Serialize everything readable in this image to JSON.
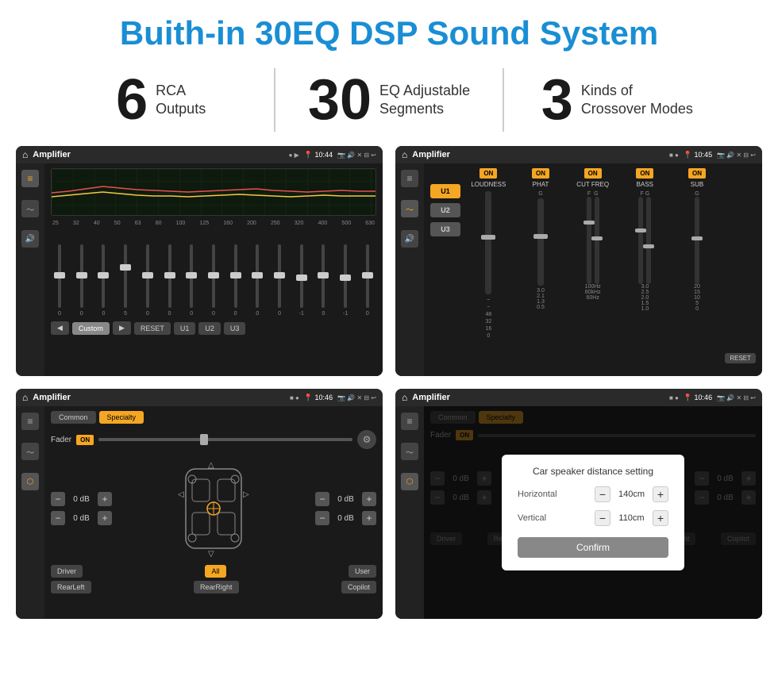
{
  "page": {
    "title": "Buith-in 30EQ DSP Sound System",
    "stats": [
      {
        "number": "6",
        "label": "RCA\nOutputs"
      },
      {
        "number": "30",
        "label": "EQ Adjustable\nSegments"
      },
      {
        "number": "3",
        "label": "Kinds of\nCrossover Modes"
      }
    ],
    "screens": [
      {
        "id": "screen1",
        "statusbar": {
          "title": "Amplifier",
          "time": "10:44"
        },
        "type": "eq"
      },
      {
        "id": "screen2",
        "statusbar": {
          "title": "Amplifier",
          "time": "10:45"
        },
        "type": "amp2"
      },
      {
        "id": "screen3",
        "statusbar": {
          "title": "Amplifier",
          "time": "10:46"
        },
        "type": "crossover"
      },
      {
        "id": "screen4",
        "statusbar": {
          "title": "Amplifier",
          "time": "10:46"
        },
        "type": "crossover-dialog",
        "dialog": {
          "title": "Car speaker distance setting",
          "horizontal_label": "Horizontal",
          "horizontal_value": "140cm",
          "vertical_label": "Vertical",
          "vertical_value": "110cm",
          "confirm_label": "Confirm"
        }
      }
    ],
    "eq": {
      "freqs": [
        "25",
        "32",
        "40",
        "50",
        "63",
        "80",
        "100",
        "125",
        "160",
        "200",
        "250",
        "320",
        "400",
        "500",
        "630"
      ],
      "values": [
        "0",
        "0",
        "0",
        "5",
        "0",
        "0",
        "0",
        "0",
        "0",
        "0",
        "0",
        "-1",
        "0",
        "-1"
      ],
      "presets": [
        "Custom",
        "RESET",
        "U1",
        "U2",
        "U3"
      ]
    },
    "amp2": {
      "presets": [
        "U1",
        "U2",
        "U3"
      ],
      "channels": [
        {
          "name": "LOUDNESS",
          "on": true
        },
        {
          "name": "PHAT",
          "on": true
        },
        {
          "name": "CUT FREQ",
          "on": true
        },
        {
          "name": "BASS",
          "on": true
        },
        {
          "name": "SUB",
          "on": true
        }
      ],
      "reset_label": "RESET"
    },
    "crossover": {
      "tabs": [
        "Common",
        "Specialty"
      ],
      "fader_label": "Fader",
      "fader_on": "ON",
      "vol_rows": [
        {
          "value": "0 dB"
        },
        {
          "value": "0 dB"
        },
        {
          "value": "0 dB"
        },
        {
          "value": "0 dB"
        }
      ],
      "buttons": [
        "Driver",
        "All",
        "User",
        "RearLeft",
        "RearRight",
        "Copilot"
      ]
    },
    "dialog": {
      "title": "Car speaker distance setting",
      "horizontal_label": "Horizontal",
      "horizontal_value": "140cm",
      "vertical_label": "Vertical",
      "vertical_value": "110cm",
      "confirm_label": "Confirm"
    }
  }
}
